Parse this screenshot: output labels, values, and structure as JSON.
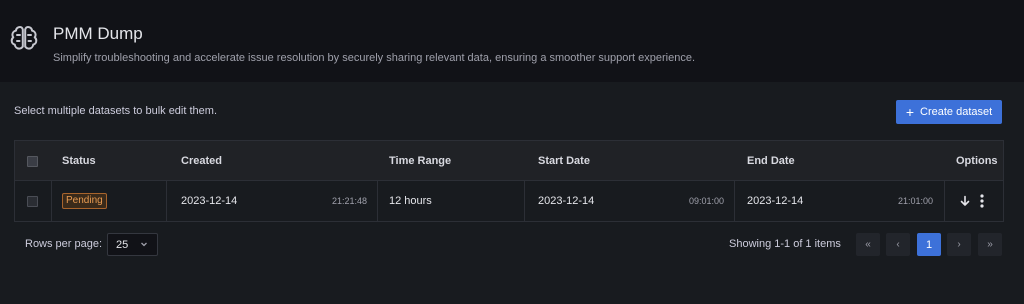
{
  "header": {
    "title": "PMM Dump",
    "subtitle": "Simplify troubleshooting and accelerate issue resolution by securely sharing relevant data, ensuring a smoother support experience.",
    "icon": "brain-icon"
  },
  "toolbar": {
    "bulk_hint": "Select multiple datasets to bulk edit them.",
    "create_label": "Create dataset",
    "create_icon": "plus-icon",
    "accent": "#3d71d9"
  },
  "table": {
    "columns": [
      "Status",
      "Created",
      "Time Range",
      "Start Date",
      "End Date",
      "Options"
    ],
    "rows": [
      {
        "status": "Pending",
        "created_date": "2023-12-14",
        "created_time": "21:21:48",
        "time_range": "12 hours",
        "start_date": "2023-12-14",
        "start_time": "09:01:00",
        "end_date": "2023-12-14",
        "end_time": "21:01:00"
      }
    ]
  },
  "pagination": {
    "rows_label": "Rows per page:",
    "rows_value": "25",
    "showing": "Showing 1-1 of 1 items",
    "first": "«",
    "prev": "‹",
    "current": "1",
    "next": "›",
    "last": "»"
  }
}
